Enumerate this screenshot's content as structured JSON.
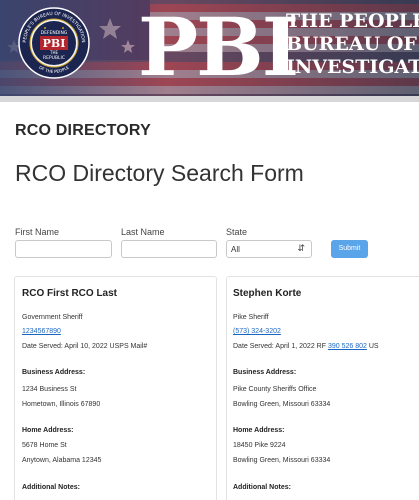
{
  "banner": {
    "seal_text_top": "PEOPLE'S BUREAU OF INVESTIGATION",
    "seal_text_mid1": "DEFENDING",
    "seal_text_mid2": "PBI",
    "seal_text_mid3": "THE",
    "seal_text_mid4": "REPUBLIC",
    "seal_text_bottom": "OF THE PEOPLE",
    "logo": "PBI",
    "line1": "THE PEOPLE'S",
    "line2": "BUREAU OF",
    "line3": "INVESTIGATIO"
  },
  "page": {
    "section_label": "RCO DIRECTORY",
    "form_title": "RCO Directory Search Form"
  },
  "form": {
    "first_name_label": "First Name",
    "last_name_label": "Last Name",
    "state_label": "State",
    "state_value": "All",
    "submit_label": "Submit"
  },
  "cards": [
    {
      "name": "RCO First RCO Last",
      "title": "Government Sheriff",
      "phone": "1234567890",
      "served_text": "Date Served: April 10, 2022 USPS Mail#",
      "served_link": "",
      "served_suffix": "",
      "business_label": "Business Address:",
      "business_line1": "1234 Business St",
      "business_line2": "Hometown, Illinois 67890",
      "home_label": "Home Address:",
      "home_line1": "5678 Home St",
      "home_line2": "Anytown, Alabama 12345",
      "notes_label": "Additional Notes:"
    },
    {
      "name": "Stephen Korte",
      "title": "Pike Sheriff",
      "phone": "(573) 324-3202",
      "served_text": "Date Served: April 1, 2022 RF",
      "served_link": "390 526 802",
      "served_suffix": "US",
      "business_label": "Business Address:",
      "business_line1": "Pike County Sheriffs Office",
      "business_line2": "Bowling Green, Missouri 63334",
      "home_label": "Home Address:",
      "home_line1": "18450 Pike 9224",
      "home_line2": "Bowling Green, Missouri 63334",
      "notes_label": "Additional Notes:"
    }
  ],
  "colors": {
    "accent": "#5aa4ea",
    "link": "#1a66c2"
  }
}
